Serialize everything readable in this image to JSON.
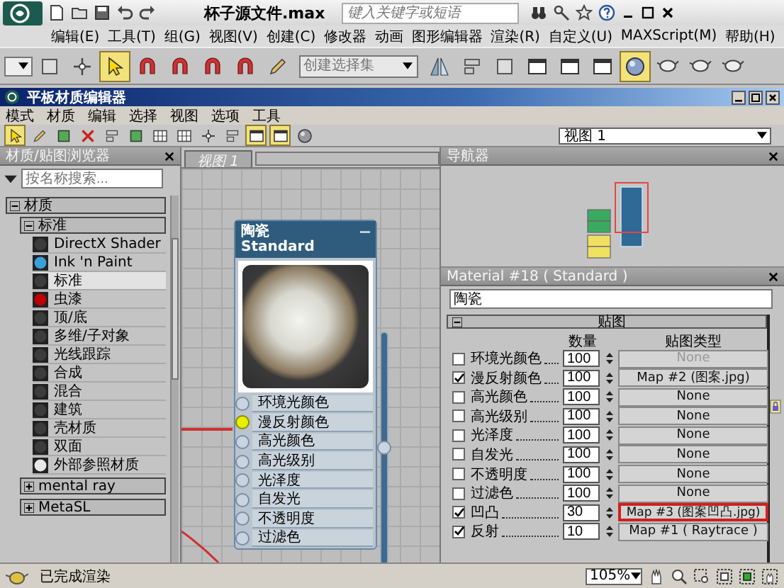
{
  "app": {
    "title": "杯子源文件.max",
    "search": {
      "placeholder": "键入关键字或短语"
    }
  },
  "menu": [
    "编辑(E)",
    "工具(T)",
    "组(G)",
    "视图(V)",
    "创建(C)",
    "修改器",
    "动画",
    "图形编辑器",
    "渲染(R)",
    "自定义(U)",
    "MAXScript(M)",
    "帮助(H)"
  ],
  "main_toolbar": [
    {
      "kind": "combo",
      "active": false
    },
    {
      "kind": "box",
      "active": false
    },
    {
      "kind": "axes",
      "active": false
    },
    {
      "kind": "cursor",
      "active": true
    },
    {
      "kind": "magnet",
      "active": false
    },
    {
      "kind": "magnet",
      "active": false
    },
    {
      "kind": "magnet",
      "active": false
    },
    {
      "kind": "magnet",
      "active": false
    },
    {
      "kind": "pencil",
      "active": false
    },
    {
      "kind": "selection-set",
      "placeholder": "创建选择集"
    },
    {
      "kind": "mirror",
      "active": false
    },
    {
      "kind": "bars",
      "active": false
    },
    {
      "kind": "box",
      "active": false
    },
    {
      "kind": "window",
      "active": false
    },
    {
      "kind": "window",
      "active": false
    },
    {
      "kind": "window",
      "active": false
    },
    {
      "kind": "sphere",
      "active": true
    },
    {
      "kind": "teapot",
      "active": false
    },
    {
      "kind": "teapot",
      "active": false
    },
    {
      "kind": "teapot",
      "active": false
    }
  ],
  "editor": {
    "title": "平板材质编辑器",
    "menu": [
      "模式",
      "材质",
      "编辑",
      "选择",
      "视图",
      "选项",
      "工具"
    ],
    "toolbar": [
      {
        "kind": "cursor",
        "active": true
      },
      {
        "kind": "pencil",
        "active": false
      },
      {
        "kind": "box",
        "active": false
      },
      {
        "kind": "cross",
        "active": false
      },
      {
        "kind": "bars",
        "active": false
      },
      {
        "kind": "box",
        "active": false
      },
      {
        "kind": "grid",
        "active": false
      },
      {
        "kind": "grid",
        "active": false
      },
      {
        "kind": "axes",
        "active": false
      },
      {
        "kind": "bars",
        "active": false
      },
      {
        "kind": "window",
        "active": true
      },
      {
        "kind": "window",
        "active": true
      },
      {
        "kind": "sphere",
        "active": false
      }
    ],
    "view_select": "视图 1"
  },
  "browser": {
    "title": "材质/贴图浏览器",
    "search": {
      "placeholder": "按名称搜索..."
    },
    "groups": [
      {
        "label": "材质",
        "expanded": true,
        "children": [
          {
            "label": "标准",
            "expanded": true,
            "items": [
              {
                "label": "DirectX Shader",
                "color": "#3c3c3c",
                "selected": false
              },
              {
                "label": "Ink 'n Paint",
                "color": "#3aa0d8",
                "selected": false
              },
              {
                "label": "标准",
                "color": "#3c3c3c",
                "selected": true
              },
              {
                "label": "虫漆",
                "color": "#c00000",
                "selected": false
              },
              {
                "label": "顶/底",
                "color": "#3c3c3c",
                "selected": false
              },
              {
                "label": "多维/子对象",
                "color": "#3c3c3c",
                "selected": false
              },
              {
                "label": "光线跟踪",
                "color": "#3c3c3c",
                "selected": false
              },
              {
                "label": "合成",
                "color": "#3c3c3c",
                "selected": false
              },
              {
                "label": "混合",
                "color": "#3c3c3c",
                "selected": false
              },
              {
                "label": "建筑",
                "color": "#3c3c3c",
                "selected": false
              },
              {
                "label": "壳材质",
                "color": "#3c3c3c",
                "selected": false
              },
              {
                "label": "双面",
                "color": "#3c3c3c",
                "selected": false
              },
              {
                "label": "外部参照材质",
                "color": "#e8e8e8",
                "selected": false
              }
            ]
          },
          {
            "label": "mental ray",
            "expanded": false
          },
          {
            "label": "MetaSL",
            "expanded": false
          }
        ]
      }
    ]
  },
  "view": {
    "tab": "视图 1",
    "node": {
      "title": "陶瓷",
      "subtitle": "Standard",
      "slots": [
        {
          "label": "环境光颜色",
          "connected": false
        },
        {
          "label": "漫反射颜色",
          "connected": true
        },
        {
          "label": "高光颜色",
          "connected": false
        },
        {
          "label": "高光级别",
          "connected": false
        },
        {
          "label": "光泽度",
          "connected": false
        },
        {
          "label": "自发光",
          "connected": false
        },
        {
          "label": "不透明度",
          "connected": false
        },
        {
          "label": "过滤色",
          "connected": false
        }
      ]
    }
  },
  "navigator": {
    "title": "导航器"
  },
  "material": {
    "title": "Material #18 ( Standard )",
    "name": "陶瓷",
    "rollout": {
      "title": "贴图",
      "expanded": true,
      "columns": [
        "数量",
        "贴图类型"
      ],
      "rows": [
        {
          "label": "环境光颜色",
          "checked": false,
          "amount": "100",
          "map": "None",
          "disabled": true,
          "highlighted": false
        },
        {
          "label": "漫反射颜色",
          "checked": true,
          "amount": "100",
          "map": "Map #2 (图案.jpg)",
          "disabled": false,
          "highlighted": false
        },
        {
          "label": "高光颜色",
          "checked": false,
          "amount": "100",
          "map": "None",
          "disabled": false,
          "highlighted": false
        },
        {
          "label": "高光级别",
          "checked": false,
          "amount": "100",
          "map": "None",
          "disabled": false,
          "highlighted": false
        },
        {
          "label": "光泽度",
          "checked": false,
          "amount": "100",
          "map": "None",
          "disabled": false,
          "highlighted": false
        },
        {
          "label": "自发光",
          "checked": false,
          "amount": "100",
          "map": "None",
          "disabled": false,
          "highlighted": false
        },
        {
          "label": "不透明度",
          "checked": false,
          "amount": "100",
          "map": "None",
          "disabled": false,
          "highlighted": false
        },
        {
          "label": "过滤色",
          "checked": false,
          "amount": "100",
          "map": "None",
          "disabled": false,
          "highlighted": false
        },
        {
          "label": "凹凸",
          "checked": true,
          "amount": "30",
          "map": "Map #3 (图案凹凸.jpg)",
          "disabled": false,
          "highlighted": true
        },
        {
          "label": "反射",
          "checked": true,
          "amount": "10",
          "map": "Map #1 ( Raytrace )",
          "disabled": false,
          "highlighted": false
        }
      ]
    }
  },
  "status": {
    "message": "已完成渲染",
    "zoom": "105%"
  }
}
